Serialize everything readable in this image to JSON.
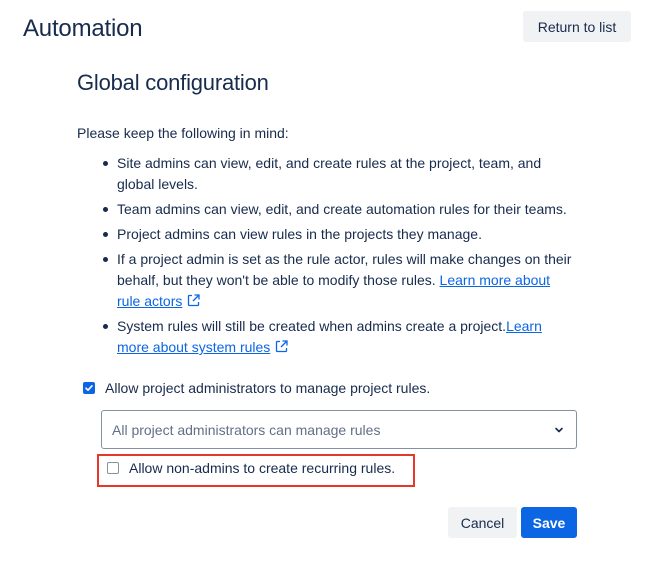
{
  "header": {
    "app_title": "Automation",
    "return_label": "Return to list"
  },
  "page": {
    "title": "Global configuration",
    "intro": "Please keep the following in mind:"
  },
  "bullets": [
    {
      "text": "Site admins can view, edit, and create rules at the project, team, and global levels."
    },
    {
      "text": "Team admins can view, edit, and create automation rules for their teams."
    },
    {
      "text": "Project admins can view rules in the projects they manage."
    },
    {
      "text": "If a project admin is set as the rule actor, rules will make changes on their behalf, but they won't be able to modify those rules. ",
      "link": "Learn more about rule actors"
    },
    {
      "text": "System rules will still be created when admins create a project.",
      "link": "Learn more about system rules"
    }
  ],
  "settings": {
    "allow_project_admins": {
      "label": "Allow project administrators to manage project rules.",
      "checked": true
    },
    "admin_scope_select": {
      "value": "All project administrators can manage rules"
    },
    "allow_non_admins_recurring": {
      "label": "Allow non-admins to create recurring rules.",
      "checked": false
    }
  },
  "footer": {
    "cancel_label": "Cancel",
    "save_label": "Save"
  },
  "colors": {
    "primary": "#0c66e4",
    "text": "#172b4d",
    "subtle_text": "#626f86",
    "neutral_button": "#f1f2f4",
    "highlight": "#e5382a"
  },
  "icons": {
    "external_link": "external-link-icon",
    "chevron": "chevron-down-icon",
    "check": "check-icon"
  }
}
